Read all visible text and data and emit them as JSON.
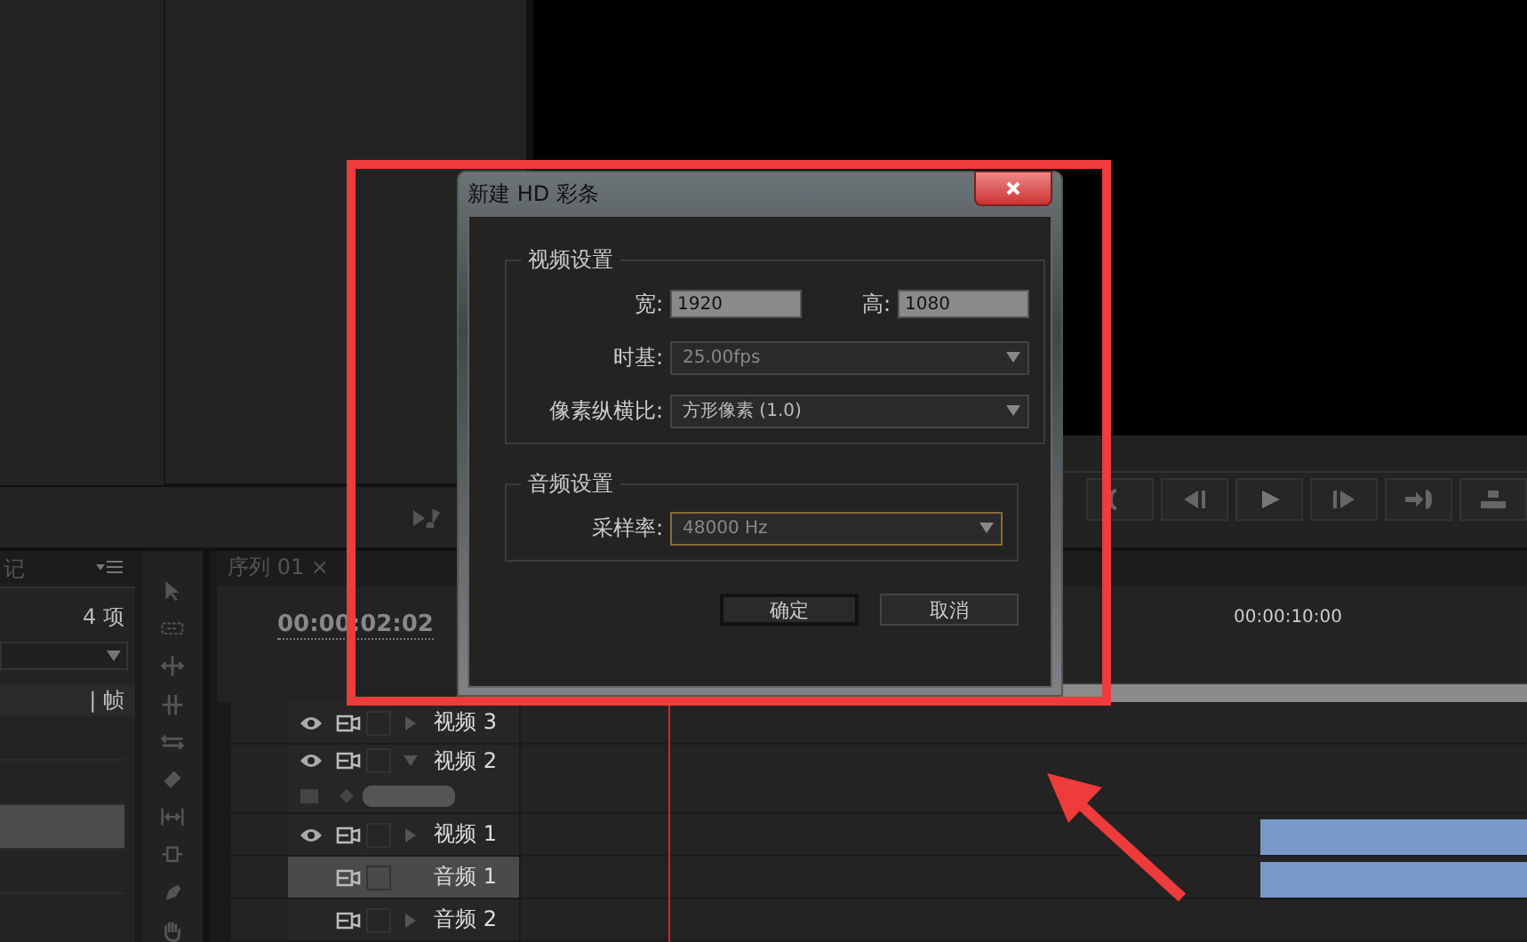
{
  "project_panel": {
    "tab": "记",
    "item_count": "4 项",
    "column": "| 帧",
    "rows": [
      {
        "selected": false
      },
      {
        "selected": false
      },
      {
        "selected": true
      },
      {
        "selected": false
      }
    ]
  },
  "sequence": {
    "tab": "序列 01",
    "close": "×",
    "timecode": "00:00:02:02",
    "ruler_time": "00:00:10:00"
  },
  "tracks": [
    {
      "name": "视频 3",
      "kind": "video",
      "expanded": false,
      "selected": false
    },
    {
      "name": "视频 2",
      "kind": "video",
      "expanded": true,
      "selected": false
    },
    {
      "name": "视频 1",
      "kind": "video",
      "expanded": false,
      "selected": false
    },
    {
      "name": "音频 1",
      "kind": "audio",
      "expanded": false,
      "selected": true
    },
    {
      "name": "音频 2",
      "kind": "audio",
      "expanded": false,
      "selected": false
    }
  ],
  "dialog": {
    "title": "新建 HD 彩条",
    "video_group": {
      "title": "视频设置",
      "width_label": "宽:",
      "width_value": "1920",
      "height_label": "高:",
      "height_value": "1080",
      "timebase_label": "时基:",
      "timebase_value": "25.00fps",
      "par_label": "像素纵横比:",
      "par_value": "方形像素 (1.0)"
    },
    "audio_group": {
      "title": "音频设置",
      "rate_label": "采样率:",
      "rate_value": "48000 Hz",
      "focused": true
    },
    "buttons": [
      {
        "label": "确定",
        "default": true
      },
      {
        "label": "取消",
        "default": false
      }
    ]
  }
}
